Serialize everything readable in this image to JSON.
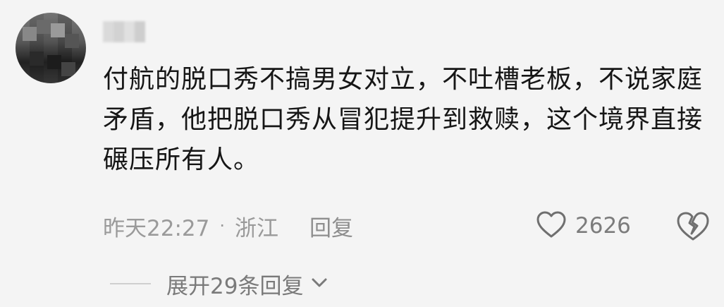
{
  "comment": {
    "text": "付航的脱口秀不搞男女对立，不吐槽老板，不说家庭矛盾，他把脱口秀从冒犯提升到救赎，这个境界直接碾压所有人。",
    "time": "昨天22:27",
    "separator": "·",
    "location": "浙江",
    "reply_label": "回复",
    "likes": "2626",
    "expand_label": "展开29条回复"
  },
  "icons": {
    "like": "heart-outline-icon",
    "dislike": "broken-heart-icon",
    "expand": "chevron-down-icon"
  }
}
